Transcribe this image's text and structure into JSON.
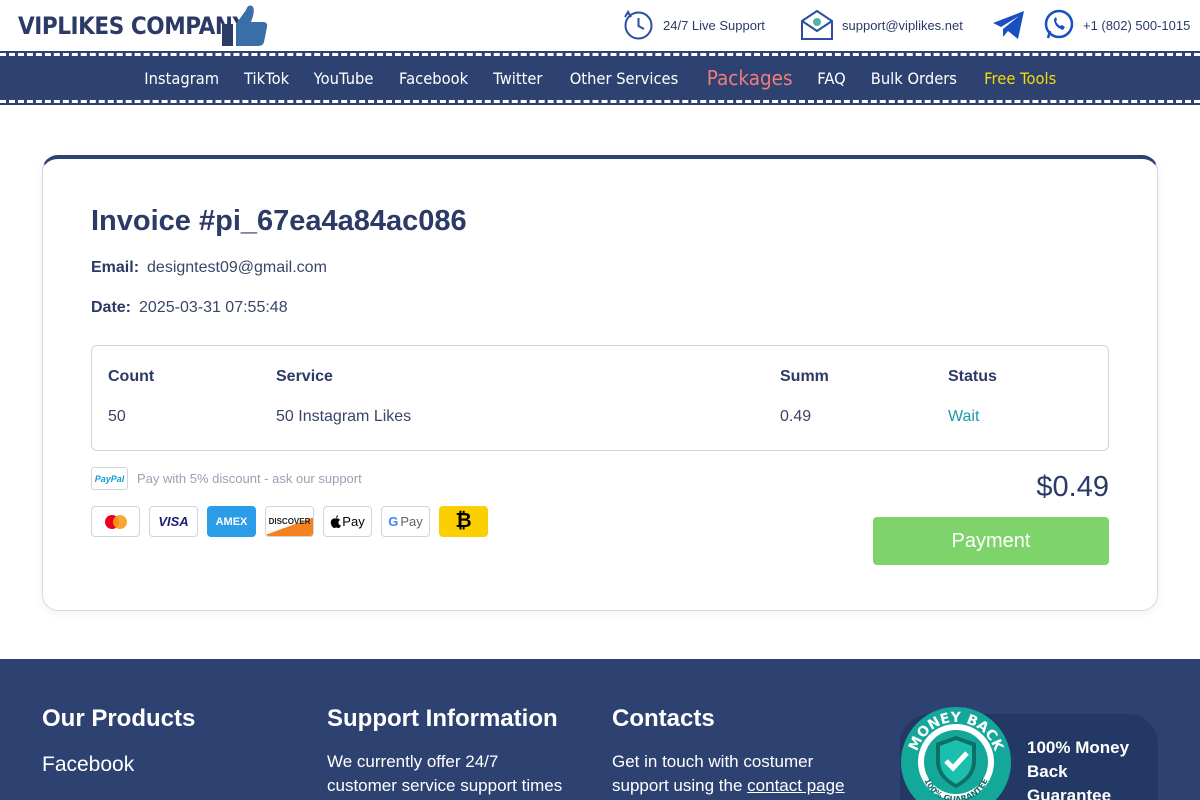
{
  "header": {
    "logo_text": "VIPLIKES COMPANY",
    "support_label": "24/7 Live Support",
    "email": "support@viplikes.net",
    "phone": "+1 (802) 500-1015",
    "icons": [
      "clock-support-icon",
      "email-icon",
      "telegram-icon",
      "whatsapp-icon",
      "thumbs-up-icon"
    ]
  },
  "nav": {
    "items": [
      {
        "label": "Instagram"
      },
      {
        "label": "TikTok"
      },
      {
        "label": "YouTube"
      },
      {
        "label": "Facebook"
      },
      {
        "label": "Twitter"
      },
      {
        "label": "Other Services"
      },
      {
        "label": "Packages",
        "active": true
      },
      {
        "label": "FAQ"
      },
      {
        "label": "Bulk Orders"
      },
      {
        "label": "Free Tools",
        "highlight": true
      }
    ]
  },
  "invoice": {
    "title": "Invoice #pi_67ea4a84ac086",
    "email_label": "Email:",
    "email_value": "designtest09@gmail.com",
    "date_label": "Date:",
    "date_value": "2025-03-31 07:55:48",
    "columns": [
      "Count",
      "Service",
      "Summ",
      "Status"
    ],
    "rows": [
      {
        "count": "50",
        "service": "50 Instagram Likes",
        "summ": "0.49",
        "status": "Wait"
      }
    ],
    "paypal_label": "PayPal",
    "paypal_note": "Pay with 5% discount - ask our support",
    "payment_methods": [
      {
        "name": "mastercard-icon",
        "label": ""
      },
      {
        "name": "visa-icon",
        "label": "VISA"
      },
      {
        "name": "amex-icon",
        "label": "AMEX"
      },
      {
        "name": "discover-icon",
        "label": "DISCOVER"
      },
      {
        "name": "apple-pay-icon",
        "label": "Pay"
      },
      {
        "name": "google-pay-icon",
        "label": "Pay"
      },
      {
        "name": "bitcoin-icon",
        "label": "₿"
      }
    ],
    "total": "$0.49",
    "pay_button": "Payment"
  },
  "footer": {
    "products_title": "Our Products",
    "products_first": "Facebook",
    "support_title": "Support Information",
    "support_text_1": "We currently offer 24/7",
    "support_text_2": "customer service support times",
    "contacts_title": "Contacts",
    "contacts_text_1": "Get in touch with costumer",
    "contacts_text_2": "support using the",
    "contacts_link": "contact page",
    "guarantee_1": "100% Money",
    "guarantee_2": "Back",
    "guarantee_3": "Guarantee",
    "seal_top": "MONEY BACK",
    "seal_bottom": "100% GUARANTEE"
  },
  "colors": {
    "navy": "#2e4272",
    "accent_red": "#f07b7b",
    "accent_yellow": "#f5d90a",
    "pay_green": "#7ed36b",
    "status_teal": "#1a9aa8"
  }
}
